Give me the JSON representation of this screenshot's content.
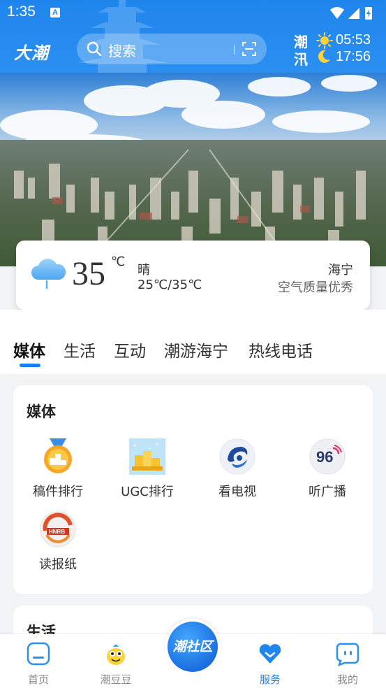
{
  "status_bar": {
    "time": "1:35",
    "notification_glyph": "A"
  },
  "header": {
    "brand": "大潮",
    "search": {
      "placeholder": "搜索"
    },
    "tide": {
      "label_top": "潮",
      "label_bottom": "汛",
      "high_time": "05:53",
      "low_time": "17:56"
    }
  },
  "weather": {
    "temperature": "35",
    "unit": "℃",
    "condition": "晴",
    "range": "25℃/35℃",
    "city": "海宁",
    "air_quality": "空气质量优秀"
  },
  "tabs": [
    {
      "label": "媒体",
      "active": true
    },
    {
      "label": "生活",
      "active": false
    },
    {
      "label": "互动",
      "active": false
    },
    {
      "label": "潮游海宁",
      "active": false
    },
    {
      "label": "热线电话",
      "active": false
    }
  ],
  "media_section": {
    "title": "媒体",
    "items": [
      {
        "label": "稿件排行",
        "icon": "medal-icon"
      },
      {
        "label": "UGC排行",
        "icon": "podium-icon"
      },
      {
        "label": "看电视",
        "icon": "tv-logo-icon"
      },
      {
        "label": "听广播",
        "icon": "radio-96-icon"
      },
      {
        "label": "读报纸",
        "icon": "newspaper-hnrb-icon"
      }
    ]
  },
  "life_section": {
    "title": "生活"
  },
  "bottom_nav": {
    "items": [
      {
        "label": "首页",
        "icon": "home-icon",
        "active": false
      },
      {
        "label": "潮豆豆",
        "icon": "mascot-icon",
        "active": false
      },
      {
        "label": "服务",
        "icon": "heart-service-icon",
        "active": true
      },
      {
        "label": "我的",
        "icon": "profile-icon",
        "active": false
      }
    ],
    "center_label": "潮社区"
  },
  "colors": {
    "accent": "#1a7ff0",
    "header": "#1f86ee"
  }
}
